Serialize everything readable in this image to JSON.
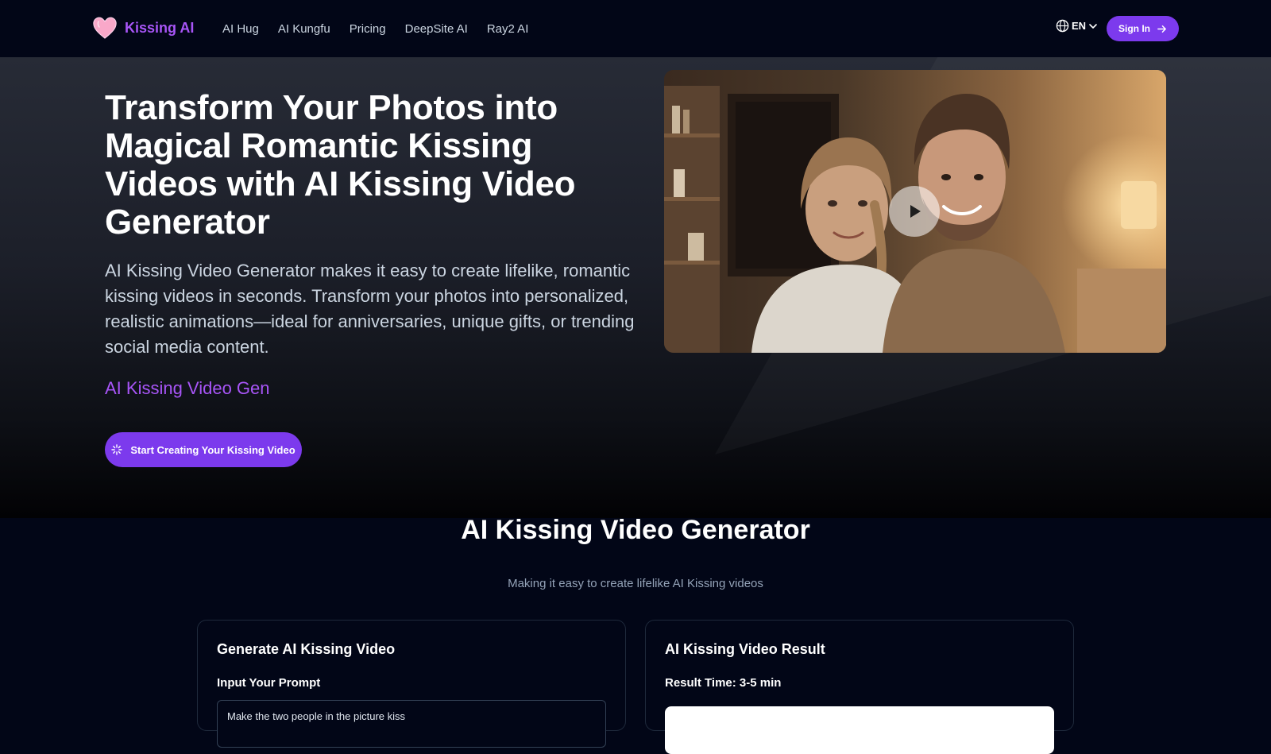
{
  "nav": {
    "brand": "Kissing AI",
    "links": [
      "AI Hug",
      "AI Kungfu",
      "Pricing",
      "DeepSite AI",
      "Ray2 AI"
    ],
    "language": "EN",
    "signin_label": "Sign In"
  },
  "hero": {
    "title": "Transform Your Photos into Magical Romantic Kissing Videos with AI Kissing Video Generator",
    "description": "AI Kissing Video Generator makes it easy to create lifelike, romantic kissing videos in seconds. Transform your photos into personalized, realistic animations—ideal for anniversaries, unique gifts, or trending social media content.",
    "tagline": "AI Kissing Video Gen",
    "cta_label": "Start Creating Your Kissing Video"
  },
  "generator": {
    "title": "AI Kissing Video Generator",
    "subtitle": "Making it easy to create lifelike AI Kissing videos",
    "input_card": {
      "title": "Generate AI Kissing Video",
      "prompt_label": "Input Your Prompt",
      "prompt_value": "Make the two people in the picture kiss"
    },
    "result_card": {
      "title": "AI Kissing Video Result",
      "result_time": "Result Time: 3-5 min"
    }
  },
  "colors": {
    "accent": "#7c3aed",
    "brand_text": "#a855f7",
    "page_bg": "#020617"
  },
  "icons": [
    "heart-logo-icon",
    "globe-icon",
    "chevron-down-icon",
    "arrow-right-icon",
    "sparkle-icon",
    "play-icon"
  ]
}
